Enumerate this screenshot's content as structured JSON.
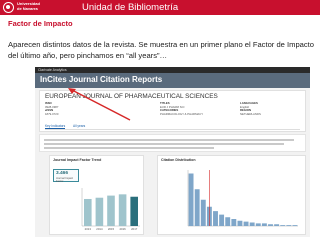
{
  "header": {
    "logo_text": "Universidad\nde Navarra",
    "title": "Unidad de Bibliometría",
    "accent_color": "#c8102e"
  },
  "section_title": "Factor de Impacto",
  "description": "Aparecen distintos datos de la revista. Se muestra en un primer plano el Factor de Impacto del último año, pero pinchamos en “all years”…",
  "screenshot": {
    "top_bar_text": "Clarivate Analytics",
    "app_title": "InCites Journal Citation Reports",
    "journal_title": "EUROPEAN JOURNAL OF PHARMACEUTICAL SCIENCES",
    "tabs": [
      "Key Indicators",
      "All years"
    ],
    "trend_card": {
      "title": "Journal Impact Factor Trend",
      "value": "3.466",
      "value_label": "Journal Impact Factor",
      "x_labels": [
        "2013",
        "2014",
        "2015",
        "2016",
        "2017"
      ]
    },
    "distribution_card": {
      "title": "Citation Distribution"
    }
  },
  "chart_data": [
    {
      "type": "bar",
      "title": "Journal Impact Factor Trend",
      "categories": [
        "2013",
        "2014",
        "2015",
        "2016",
        "2017"
      ],
      "values": [
        3.2,
        3.35,
        3.6,
        3.75,
        3.466
      ]
    },
    {
      "type": "bar",
      "title": "Citation Distribution",
      "values": [
        60,
        42,
        30,
        22,
        17,
        13,
        10,
        8,
        6,
        5,
        4,
        3,
        3,
        2,
        2,
        1,
        1,
        1
      ],
      "series": [
        {
          "values": [
            60,
            42,
            30,
            22,
            17,
            13,
            10,
            8,
            6,
            5,
            4,
            3,
            3,
            2,
            2,
            1,
            1,
            1
          ]
        }
      ]
    }
  ]
}
